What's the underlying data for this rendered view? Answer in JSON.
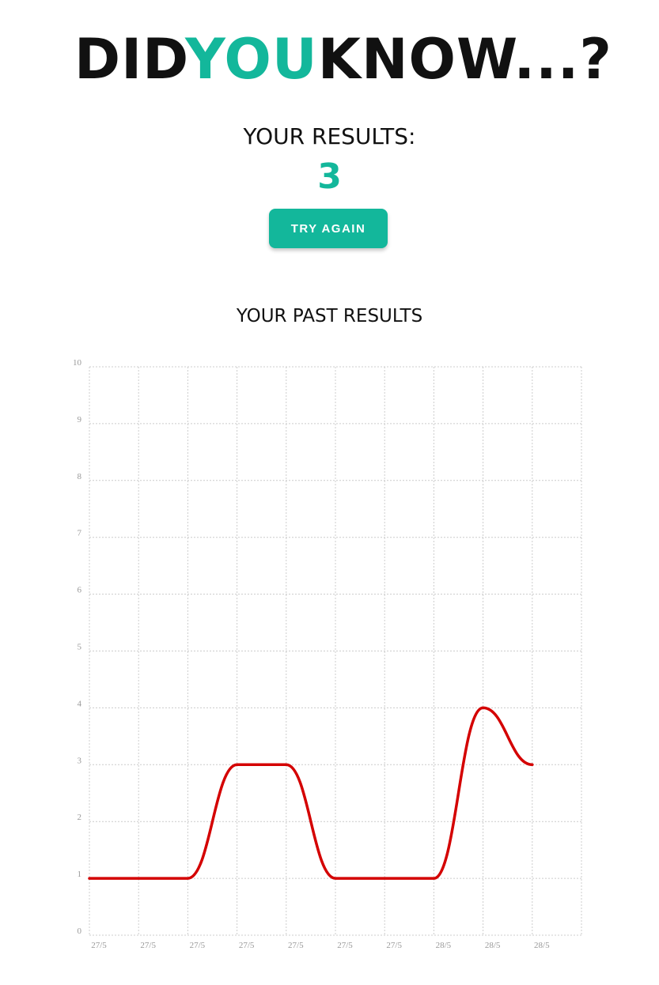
{
  "logo": {
    "part1": "DID",
    "part2": "YOU",
    "part3": "KNOW...?",
    "icon": "megaphone-icon",
    "accent_color": "#13b79b"
  },
  "results": {
    "label": "YOUR RESULTS:",
    "score": "3"
  },
  "try_again": {
    "label": "TRY AGAIN"
  },
  "past": {
    "label": "YOUR PAST RESULTS"
  },
  "chart_data": {
    "type": "line",
    "categories": [
      "27/5",
      "27/5",
      "27/5",
      "27/5",
      "27/5",
      "27/5",
      "27/5",
      "28/5",
      "28/5",
      "28/5"
    ],
    "series": [
      {
        "values": [
          1,
          1,
          1,
          3,
          3,
          1,
          1,
          1,
          4,
          3
        ],
        "color": "#d40000"
      }
    ],
    "ylim": [
      0,
      10
    ],
    "yticks": [
      0,
      1,
      2,
      3,
      4,
      5,
      6,
      7,
      8,
      9,
      10
    ],
    "grid": true,
    "title": "",
    "xlabel": "",
    "ylabel": ""
  }
}
